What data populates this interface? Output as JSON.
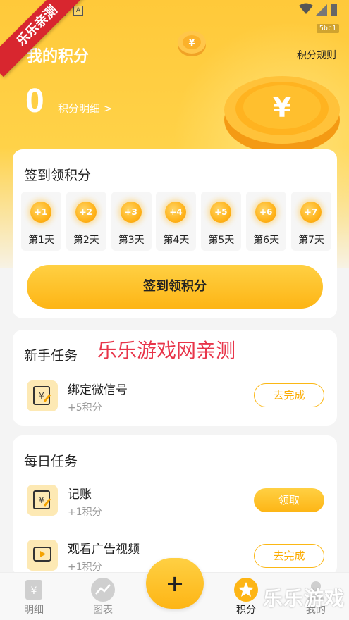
{
  "status_bar": {
    "indicator": "A",
    "tag": "5bc1"
  },
  "ribbon": {
    "text": "乐乐亲测"
  },
  "header": {
    "title": "我的积分",
    "rules_link": "积分规则",
    "points": "0",
    "points_detail": "积分明细 >"
  },
  "checkin": {
    "title": "签到领积分",
    "days": [
      {
        "reward": "+1",
        "label": "第1天"
      },
      {
        "reward": "+2",
        "label": "第2天"
      },
      {
        "reward": "+3",
        "label": "第3天"
      },
      {
        "reward": "+4",
        "label": "第4天"
      },
      {
        "reward": "+5",
        "label": "第5天"
      },
      {
        "reward": "+6",
        "label": "第6天"
      },
      {
        "reward": "+7",
        "label": "第7天"
      }
    ],
    "button_label": "签到领积分"
  },
  "novice_tasks": {
    "title": "新手任务",
    "watermark": "乐乐游戏网亲测",
    "items": [
      {
        "name": "绑定微信号",
        "reward": "+5积分",
        "action": "去完成",
        "icon": "wechat-bill-icon"
      }
    ]
  },
  "daily_tasks": {
    "title": "每日任务",
    "items": [
      {
        "name": "记账",
        "reward": "+1积分",
        "action": "领取",
        "icon": "bookkeeping-icon"
      },
      {
        "name": "观看广告视频",
        "reward": "+1积分",
        "action": "去完成",
        "icon": "video-icon"
      }
    ]
  },
  "bottom_nav": {
    "items": [
      {
        "label": "明细",
        "icon": "ledger-icon"
      },
      {
        "label": "图表",
        "icon": "chart-icon"
      },
      {
        "label": "积分",
        "icon": "star-icon",
        "active": true
      },
      {
        "label": "我的",
        "icon": "user-icon"
      }
    ],
    "fab": "+"
  },
  "brand_watermark": "乐乐游戏",
  "colors": {
    "accent": "#fdb515",
    "hero": "#ffc93a",
    "ribbon": "#d8262f",
    "watermark": "#e8354a"
  }
}
